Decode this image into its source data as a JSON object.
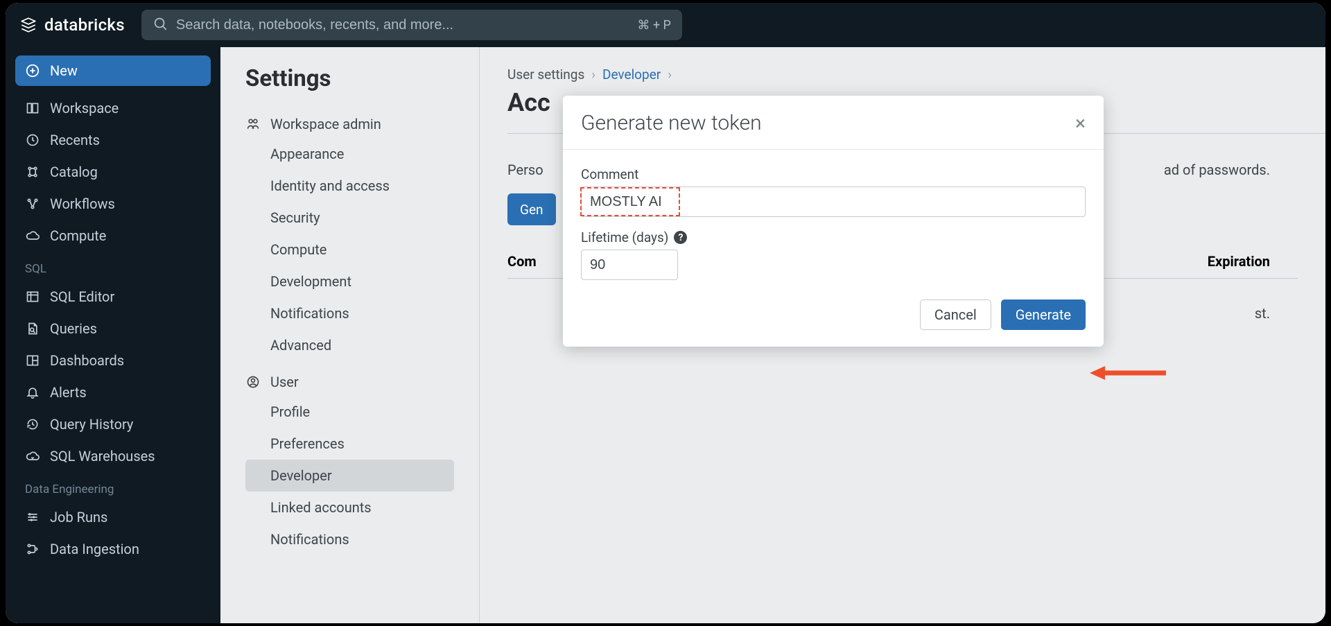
{
  "brand": {
    "name": "databricks"
  },
  "search": {
    "placeholder": "Search data, notebooks, recents, and more...",
    "shortcut": "⌘ + P"
  },
  "sidenav": {
    "new_label": "New",
    "items": [
      {
        "label": "Workspace"
      },
      {
        "label": "Recents"
      },
      {
        "label": "Catalog"
      },
      {
        "label": "Workflows"
      },
      {
        "label": "Compute"
      }
    ],
    "sections": [
      {
        "label": "SQL",
        "items": [
          {
            "label": "SQL Editor"
          },
          {
            "label": "Queries"
          },
          {
            "label": "Dashboards"
          },
          {
            "label": "Alerts"
          },
          {
            "label": "Query History"
          },
          {
            "label": "SQL Warehouses"
          }
        ]
      },
      {
        "label": "Data Engineering",
        "items": [
          {
            "label": "Job Runs"
          },
          {
            "label": "Data Ingestion"
          }
        ]
      }
    ]
  },
  "settings": {
    "title": "Settings",
    "groups": [
      {
        "header": "Workspace admin",
        "items": [
          "Appearance",
          "Identity and access",
          "Security",
          "Compute",
          "Development",
          "Notifications",
          "Advanced"
        ]
      },
      {
        "header": "User",
        "items": [
          "Profile",
          "Preferences",
          "Developer",
          "Linked accounts",
          "Notifications"
        ],
        "selected_index": 2
      }
    ]
  },
  "breadcrumb": {
    "item0": "User settings",
    "item1": "Developer"
  },
  "page": {
    "title_fragment": "Acc",
    "description_start": "Perso",
    "description_end": "ad of passwords.",
    "generate_button_fragment": "Gen",
    "table_col0": "Com",
    "table_col1": "Expiration",
    "empty_row_fragment": "st."
  },
  "modal": {
    "title": "Generate new token",
    "comment_label": "Comment",
    "comment_value": "MOSTLY AI",
    "lifetime_label": "Lifetime (days)",
    "lifetime_value": "90",
    "cancel": "Cancel",
    "generate": "Generate"
  }
}
